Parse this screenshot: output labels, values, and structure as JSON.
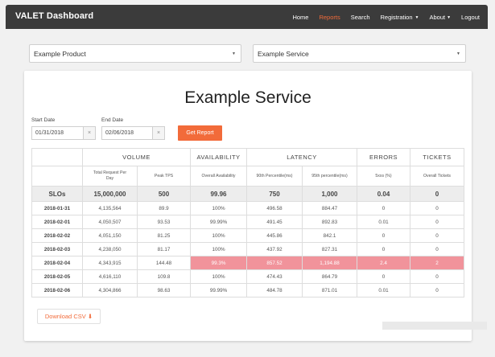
{
  "app": {
    "title": "VALET Dashboard"
  },
  "nav": {
    "items": [
      {
        "label": "Home"
      },
      {
        "label": "Reports",
        "active": true
      },
      {
        "label": "Search"
      },
      {
        "label": "Registration"
      },
      {
        "label": "About"
      },
      {
        "label": "Logout"
      }
    ]
  },
  "filters": {
    "product": "Example Product",
    "service": "Example Service"
  },
  "page": {
    "title": "Example Service",
    "start_label": "Start Date",
    "start_value": "01/31/2018",
    "end_label": "End Date",
    "end_value": "02/06/2018",
    "report_button": "Get Report",
    "download_button": "Download CSV ⬇"
  },
  "table": {
    "groups": [
      "VOLUME",
      "AVAILABILITY",
      "LATENCY",
      "ERRORS",
      "TICKETS"
    ],
    "columns": [
      "Total Request Per Day",
      "Peak TPS",
      "Overall Availability",
      "90th Percentile(ms)",
      "95th percentile(ms)",
      "5xxs (%)",
      "Overall Tickets"
    ],
    "slo": [
      "SLOs",
      "15,000,000",
      "500",
      "99.96",
      "750",
      "1,000",
      "0.04",
      "0"
    ],
    "rows": [
      [
        "2018-01-31",
        "4,135,564",
        "89.9",
        "100%",
        "496.58",
        "884.47",
        "0",
        "0"
      ],
      [
        "2018-02-01",
        "4,050,507",
        "93.53",
        "99.99%",
        "491.45",
        "892.83",
        "0.01",
        "0"
      ],
      [
        "2018-02-02",
        "4,051,150",
        "81.25",
        "100%",
        "445.86",
        "842.1",
        "0",
        "0"
      ],
      [
        "2018-02-03",
        "4,238,050",
        "81.17",
        "100%",
        "437.92",
        "827.31",
        "0",
        "0"
      ],
      [
        "2018-02-04",
        "4,343,915",
        "144.48",
        "99.3%",
        "857.52",
        "1,194.88",
        "2.4",
        "2"
      ],
      [
        "2018-02-05",
        "4,616,110",
        "109.8",
        "100%",
        "474.43",
        "864.79",
        "0",
        "0"
      ],
      [
        "2018-02-06",
        "4,304,866",
        "98.63",
        "99.99%",
        "484.78",
        "871.01",
        "0.01",
        "0"
      ]
    ]
  },
  "colors": {
    "accent": "#f26b3a",
    "navbar": "#3b3b3b",
    "error_cell": "#f1939b"
  }
}
